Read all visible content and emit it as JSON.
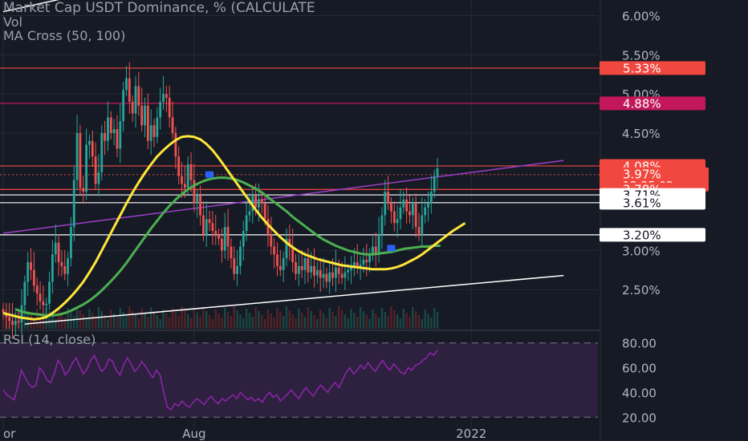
{
  "colors": {
    "background": "#161a25",
    "grid": "#262a35",
    "candle_up": "#26a69a",
    "candle_down": "#ef5350",
    "ma_fast": "#ffe63a",
    "ma_slow": "#4caf50",
    "rsi_line": "#8e24aa",
    "rsi_band": "#2e2140",
    "trendline": "#ffffff",
    "channel_line": "#9c3fc9",
    "cross_marker": "#2962ff",
    "axis_text": "#b2b5be"
  },
  "chart_data": {
    "type": "candlestick",
    "title": "Market Cap USDT Dominance, % (CALCULATE",
    "indicators": [
      "Vol",
      "MA Cross (50, 100)"
    ],
    "x_tick_labels": [
      {
        "label": "or",
        "index": 0
      },
      {
        "label": "Aug",
        "index": 62
      },
      {
        "label": "2022",
        "index": 152
      }
    ],
    "y_axis": {
      "ylim": [
        2.0,
        6.2
      ],
      "scale": "linear",
      "tick_labels": [
        "6.00%",
        "5.50%",
        "5.00%",
        "4.50%",
        "3.00%",
        "2.50%"
      ],
      "tick_values": [
        6.0,
        5.5,
        5.0,
        4.5,
        3.0,
        2.5
      ]
    },
    "price_tags": [
      {
        "label": "5.33%",
        "value": 5.33,
        "color": "#f0473f",
        "text_color": "#ffffff"
      },
      {
        "label": "4.88%",
        "value": 4.88,
        "color": "#c2185b",
        "text_color": "#ffffff"
      },
      {
        "label": "4.08%",
        "value": 4.08,
        "color": "#f0473f",
        "text_color": "#ffffff"
      },
      {
        "label": "3.97%",
        "value": 3.97,
        "color": "#f0473f",
        "text_color": "#ffffff",
        "countdown": "12:25:02"
      },
      {
        "label": "3.78%",
        "value": 3.78,
        "color": "#f0473f",
        "text_color": "#ffffff"
      },
      {
        "label": "3.71%",
        "value": 3.71,
        "color": "#ffffff",
        "text_color": "#131722"
      },
      {
        "label": "3.61%",
        "value": 3.61,
        "color": "#ffffff",
        "text_color": "#131722"
      },
      {
        "label": "3.20%",
        "value": 3.2,
        "color": "#ffffff",
        "text_color": "#131722"
      }
    ],
    "horizontal_levels": [
      {
        "value": 5.33,
        "color": "#f0473f"
      },
      {
        "value": 4.88,
        "color": "#c2185b"
      },
      {
        "value": 4.08,
        "color": "#f0473f"
      },
      {
        "value": 3.78,
        "color": "#f0473f"
      },
      {
        "value": 3.71,
        "color": "#ffffff"
      },
      {
        "value": 3.61,
        "color": "#ffffff"
      },
      {
        "value": 3.2,
        "color": "#ffffff"
      }
    ],
    "trendlines": [
      {
        "from": {
          "index": 7,
          "value": 2.06
        },
        "to": {
          "index": 182,
          "value": 2.68
        },
        "color": "#ffffff"
      },
      {
        "from": {
          "index": 0,
          "value": 3.22
        },
        "to": {
          "index": 182,
          "value": 4.15
        },
        "color": "#9c3fc9"
      },
      {
        "from": {
          "index": 0,
          "value": 6.05
        },
        "to": {
          "index": 52,
          "value": 6.5
        },
        "color": "#ffffff"
      }
    ],
    "ma_cross_markers": [
      {
        "index": 67,
        "value": 3.97
      },
      {
        "index": 126,
        "value": 3.03
      }
    ],
    "candles_close": [
      2.2,
      2.15,
      2.1,
      2.05,
      2.1,
      2.08,
      2.3,
      2.6,
      2.85,
      2.75,
      2.55,
      2.45,
      2.35,
      2.3,
      2.32,
      2.6,
      2.95,
      3.1,
      2.85,
      2.8,
      2.7,
      2.9,
      3.3,
      3.9,
      4.5,
      3.8,
      3.75,
      4.35,
      4.4,
      4.2,
      3.85,
      4.0,
      4.5,
      4.4,
      4.7,
      4.5,
      4.55,
      4.3,
      4.65,
      5.05,
      5.2,
      4.9,
      4.75,
      5.1,
      4.85,
      4.6,
      4.85,
      4.4,
      4.6,
      4.45,
      4.7,
      4.9,
      5.0,
      4.95,
      4.7,
      4.5,
      4.2,
      3.95,
      3.85,
      3.8,
      4.1,
      3.9,
      3.6,
      3.7,
      3.45,
      3.2,
      3.4,
      3.35,
      3.25,
      3.2,
      3.15,
      3.0,
      3.3,
      3.05,
      2.9,
      2.7,
      2.8,
      3.05,
      3.25,
      3.45,
      3.5,
      3.7,
      3.55,
      3.65,
      3.6,
      3.4,
      3.2,
      3.05,
      2.95,
      2.8,
      2.75,
      2.9,
      3.15,
      3.05,
      2.85,
      2.7,
      2.8,
      2.75,
      2.9,
      2.72,
      2.8,
      2.68,
      2.75,
      2.65,
      2.7,
      2.6,
      2.72,
      2.65,
      2.78,
      2.7,
      2.65,
      2.72,
      2.75,
      2.8,
      2.85,
      2.78,
      2.82,
      2.88,
      2.85,
      2.95,
      3.05,
      2.95,
      3.2,
      3.45,
      3.75,
      3.6,
      3.5,
      3.35,
      3.4,
      3.55,
      3.65,
      3.5,
      3.45,
      3.6,
      3.3,
      3.2,
      3.45,
      3.55,
      3.6,
      3.75,
      3.95,
      4.05
    ],
    "ma_fast": [
      2.2,
      2.18,
      2.16,
      2.14,
      2.13,
      2.12,
      2.13,
      2.15,
      2.2,
      2.26,
      2.33,
      2.41,
      2.5,
      2.6,
      2.72,
      2.85,
      3.0,
      3.15,
      3.3,
      3.45,
      3.6,
      3.74,
      3.87,
      3.99,
      4.1,
      4.2,
      4.28,
      4.35,
      4.41,
      4.45,
      4.46,
      4.45,
      4.42,
      4.36,
      4.28,
      4.18,
      4.07,
      3.96,
      3.85,
      3.74,
      3.63,
      3.52,
      3.42,
      3.33,
      3.25,
      3.17,
      3.1,
      3.04,
      2.99,
      2.95,
      2.92,
      2.89,
      2.87,
      2.85,
      2.83,
      2.81,
      2.8,
      2.79,
      2.78,
      2.77,
      2.76,
      2.76,
      2.76,
      2.77,
      2.79,
      2.82,
      2.86,
      2.9,
      2.95,
      3.01,
      3.07,
      3.13,
      3.19,
      3.25,
      3.3,
      3.35
    ],
    "ma_slow": [
      2.25,
      2.22,
      2.2,
      2.19,
      2.18,
      2.17,
      2.17,
      2.18,
      2.2,
      2.23,
      2.27,
      2.31,
      2.36,
      2.42,
      2.49,
      2.57,
      2.65,
      2.74,
      2.84,
      2.95,
      3.06,
      3.17,
      3.28,
      3.38,
      3.48,
      3.57,
      3.65,
      3.72,
      3.78,
      3.83,
      3.87,
      3.9,
      3.92,
      3.93,
      3.93,
      3.92,
      3.9,
      3.87,
      3.83,
      3.79,
      3.74,
      3.68,
      3.62,
      3.56,
      3.5,
      3.43,
      3.37,
      3.31,
      3.25,
      3.19,
      3.14,
      3.1,
      3.06,
      3.03,
      3.0,
      2.98,
      2.96,
      2.95,
      2.95,
      2.96,
      2.97,
      2.98,
      3.0,
      3.02,
      3.03,
      3.04,
      3.05,
      3.05,
      3.06,
      3.06
    ],
    "rsi": {
      "label": "RSI (14, close)",
      "ylim": [
        15,
        85
      ],
      "tick_labels": [
        "80.00",
        "60.00",
        "40.00",
        "20.00"
      ],
      "tick_values": [
        80,
        60,
        40,
        20
      ],
      "band": [
        30,
        70
      ],
      "values": [
        42,
        38,
        36,
        34,
        45,
        58,
        52,
        47,
        44,
        46,
        60,
        56,
        50,
        48,
        55,
        66,
        62,
        54,
        58,
        64,
        68,
        61,
        55,
        59,
        66,
        70,
        63,
        57,
        60,
        67,
        65,
        58,
        54,
        62,
        68,
        63,
        57,
        60,
        65,
        61,
        56,
        52,
        58,
        54,
        40,
        28,
        26,
        31,
        29,
        33,
        30,
        28,
        32,
        35,
        33,
        30,
        34,
        37,
        33,
        31,
        35,
        33,
        36,
        38,
        35,
        40,
        37,
        34,
        36,
        33,
        35,
        32,
        37,
        40,
        36,
        38,
        33,
        36,
        39,
        42,
        38,
        35,
        40,
        44,
        40,
        37,
        42,
        46,
        43,
        40,
        45,
        48,
        44,
        50,
        56,
        60,
        55,
        58,
        62,
        59,
        64,
        60,
        57,
        62,
        66,
        61,
        58,
        63,
        60,
        56,
        55,
        60,
        58,
        62,
        63,
        66,
        68,
        72,
        70,
        74
      ]
    }
  }
}
